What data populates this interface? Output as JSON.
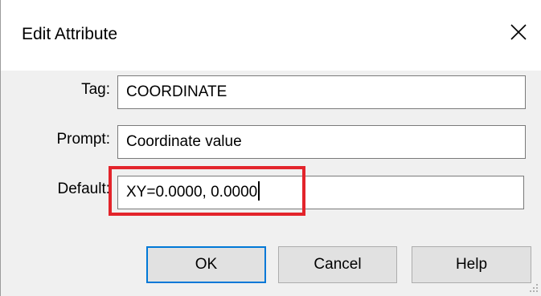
{
  "dialog": {
    "title": "Edit Attribute",
    "close_icon": "close-icon"
  },
  "fields": {
    "tag": {
      "label": "Tag:",
      "value": "COORDINATE"
    },
    "prompt": {
      "label": "Prompt:",
      "value": "Coordinate value"
    },
    "default": {
      "label": "Default:",
      "value": "XY=0.0000, 0.0000"
    }
  },
  "buttons": {
    "ok": "OK",
    "cancel": "Cancel",
    "help": "Help"
  },
  "colors": {
    "highlight": "#e3242b",
    "default_button_border": "#0078d7",
    "client_background": "#f0f0f0"
  }
}
